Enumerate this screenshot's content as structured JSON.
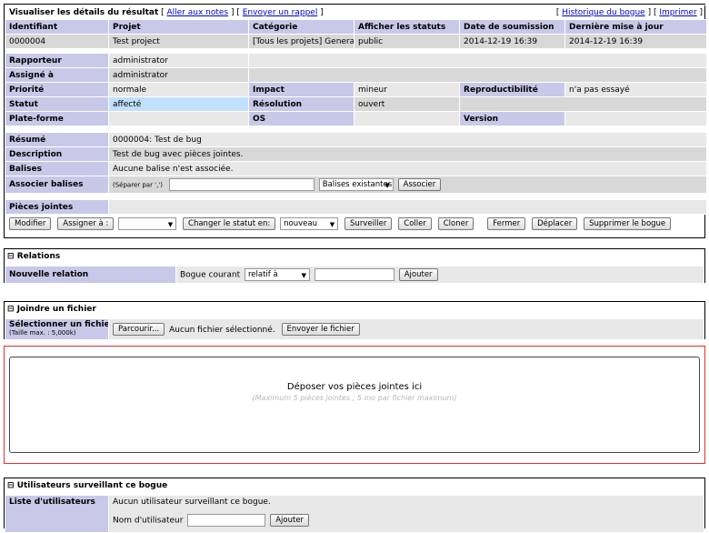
{
  "header": {
    "title": "Visualiser les détails du résultat",
    "link_notes": "Aller aux notes",
    "link_reminder": "Envoyer un rappel",
    "link_history": "Historique du bogue",
    "link_print": "Imprimer"
  },
  "columns": [
    "Identifiant",
    "Projet",
    "Catégorie",
    "Afficher les statuts",
    "Date de soumission",
    "Dernière mise à jour"
  ],
  "issue": {
    "id": "0000004",
    "project": "Test project",
    "category": "[Tous les projets] General",
    "view_status": "public",
    "date_submitted": "2014-12-19 16:39",
    "last_update": "2014-12-19 16:39"
  },
  "labels": {
    "reporter": "Rapporteur",
    "assigned": "Assigné à",
    "priority": "Priorité",
    "impact": "Impact",
    "reproducibility": "Reproductibilité",
    "status": "Statut",
    "resolution": "Résolution",
    "platform": "Plate-forme",
    "os": "OS",
    "version": "Version",
    "summary": "Résumé",
    "description": "Description",
    "tags": "Balises",
    "attach_tags": "Associer balises",
    "attachments": "Pièces jointes"
  },
  "values": {
    "reporter": "administrator",
    "assigned": "administrator",
    "priority": "normale",
    "impact": "mineur",
    "reproducibility": "n'a pas essayé",
    "status": "affecté",
    "resolution": "ouvert",
    "summary": "0000004: Test de bug",
    "description": "Test de bug avec pièces jointes.",
    "tags": "Aucune balise n'est associée.",
    "tags_hint": "(Séparer par ',')",
    "existing_tags": "Balises existantes",
    "associate_btn": "Associer"
  },
  "colors": {
    "status_assigned": "#c2dfff",
    "category_bg": "#c8c8e8",
    "dropzone_border": "#e03030"
  },
  "actions": {
    "modify": "Modifier",
    "assign_to": "Assigner à :",
    "change_status": "Changer le statut en:",
    "status_value": "nouveau",
    "monitor": "Surveiller",
    "clone": "Coller",
    "clone2": "Cloner",
    "close": "Fermer",
    "move": "Déplacer",
    "delete": "Supprimer le bogue"
  },
  "relations": {
    "title": "Relations",
    "new_relation": "Nouvelle relation",
    "current_bug": "Bogue courant",
    "relation_type": "relatif à",
    "add_btn": "Ajouter"
  },
  "upload": {
    "title": "Joindre un fichier",
    "select_label": "Sélectionner un fichier",
    "max_size": "(Taille max. : 5,000k)",
    "browse_btn": "Parcourir...",
    "no_file": "Aucun fichier sélectionné.",
    "send_btn": "Envoyer le fichier",
    "drop_text": "Déposer vos pièces jointes ici",
    "drop_hint": "(Maximum 5 pièces jointes , 5 mo par fichier maximum)"
  },
  "monitoring": {
    "title": "Utilisateurs surveillant ce bogue",
    "users_label": "Liste d'utilisateurs",
    "none_text": "Aucun utilisateur surveillant ce bogue.",
    "username_label": "Nom d'utilisateur",
    "add_btn": "Ajouter"
  }
}
